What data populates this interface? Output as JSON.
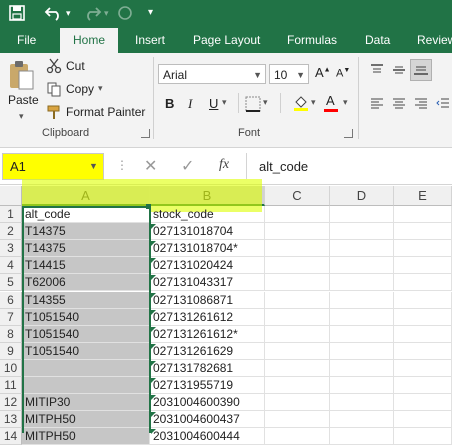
{
  "tabs": [
    "File",
    "Home",
    "Insert",
    "Page Layout",
    "Formulas",
    "Data",
    "Review"
  ],
  "ribbon": {
    "paste": "Paste",
    "cut": "Cut",
    "copy": "Copy",
    "format_painter": "Format Painter",
    "clipboard_label": "Clipboard",
    "font_name": "Arial",
    "font_size": "10",
    "font_label": "Font",
    "bold": "B",
    "italic": "I",
    "underline": "U",
    "font_color_glyph": "A"
  },
  "formula_bar": {
    "name_box": "A1",
    "fx": "fx",
    "value": "alt_code"
  },
  "grid": {
    "columns": [
      "A",
      "B",
      "C",
      "D",
      "E"
    ],
    "rows": [
      {
        "n": "1",
        "a": "alt_code",
        "b": "stock_code"
      },
      {
        "n": "2",
        "a": "T14375",
        "b": "027131018704"
      },
      {
        "n": "3",
        "a": "T14375",
        "b": "027131018704*"
      },
      {
        "n": "4",
        "a": "T14415",
        "b": "027131020424"
      },
      {
        "n": "5",
        "a": "T62006",
        "b": "027131043317"
      },
      {
        "n": "6",
        "a": "T14355",
        "b": "027131086871"
      },
      {
        "n": "7",
        "a": "T1051540",
        "b": "027131261612"
      },
      {
        "n": "8",
        "a": "T1051540",
        "b": "027131261612*"
      },
      {
        "n": "9",
        "a": "T1051540",
        "b": "027131261629"
      },
      {
        "n": "10",
        "a": "",
        "b": "027131782681"
      },
      {
        "n": "11",
        "a": "",
        "b": "027131955719"
      },
      {
        "n": "12",
        "a": "MITIP30",
        "b": "2031004600390"
      },
      {
        "n": "13",
        "a": "MITPH50",
        "b": "2031004600437"
      },
      {
        "n": "14",
        "a": "MITPH50",
        "b": "2031004600444"
      }
    ]
  },
  "colors": {
    "excel_green": "#217346",
    "highlight_yellow": "#ffff00",
    "selected_gray": "#c6c6c6"
  }
}
